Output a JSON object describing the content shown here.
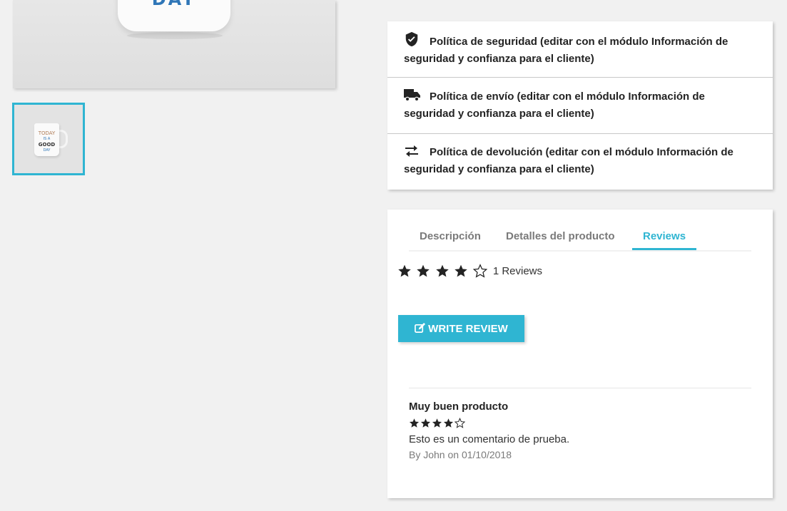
{
  "product_image": {
    "mug_text": "DAY",
    "thumbnail_lines": [
      "TODAY",
      "IS A",
      "GOOD",
      "DAY"
    ]
  },
  "reassurance": [
    {
      "icon": "shield-icon",
      "text": "Política de seguridad (editar con el módulo Información de seguridad y confianza para el cliente)"
    },
    {
      "icon": "truck-icon",
      "text": "Política de envío (editar con el módulo Información de seguridad y confianza para el cliente)"
    },
    {
      "icon": "swap-arrows-icon",
      "text": "Política de devolución (editar con el módulo Información de seguridad y confianza para el cliente)"
    }
  ],
  "tabs": [
    {
      "label": "Descripción",
      "active": false
    },
    {
      "label": "Detalles del producto",
      "active": false
    },
    {
      "label": "Reviews",
      "active": true
    }
  ],
  "rating_summary": {
    "rating": 4,
    "max": 5,
    "count_label": "1 Reviews"
  },
  "write_review_button": {
    "icon": "edit-icon",
    "label": "WRITE REVIEW"
  },
  "reviews": [
    {
      "title": "Muy buen producto",
      "rating": 4,
      "max": 5,
      "text": "Esto es un comentario de prueba.",
      "meta": "By John on 01/10/2018"
    }
  ],
  "colors": {
    "accent": "#2fb5d2",
    "background": "#f1f1f1",
    "text": "#232323"
  }
}
